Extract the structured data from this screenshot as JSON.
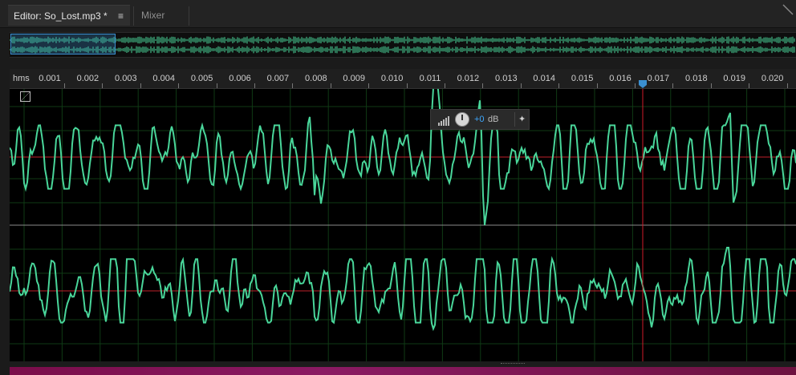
{
  "tabs": [
    {
      "label": "Editor: So_Lost.mp3 *",
      "active": true
    },
    {
      "label": "Mixer",
      "active": false
    }
  ],
  "tab_menu_glyph": "≡",
  "ruler": {
    "unit_label": "hms",
    "ticks": [
      "0.001",
      "0.002",
      "0.003",
      "0.004",
      "0.005",
      "0.006",
      "0.007",
      "0.008",
      "0.009",
      "0.010",
      "0.011",
      "0.012",
      "0.013",
      "0.014",
      "0.015",
      "0.016",
      "0.017",
      "0.018",
      "0.019",
      "0.020"
    ]
  },
  "hud": {
    "gain_value": "+0",
    "gain_unit": "dB",
    "pin_glyph": "✦"
  },
  "colors": {
    "waveform": "#49d69a",
    "center_line": "#c0202a",
    "playhead": "#d01a2a",
    "grid": "#0f3a15",
    "selection": "#3b8fd0"
  },
  "icons": {
    "hud_meter": "level-meter-icon",
    "hud_knob": "volume-knob-icon",
    "pin": "pin-icon",
    "panel": "tab-menu-icon"
  }
}
